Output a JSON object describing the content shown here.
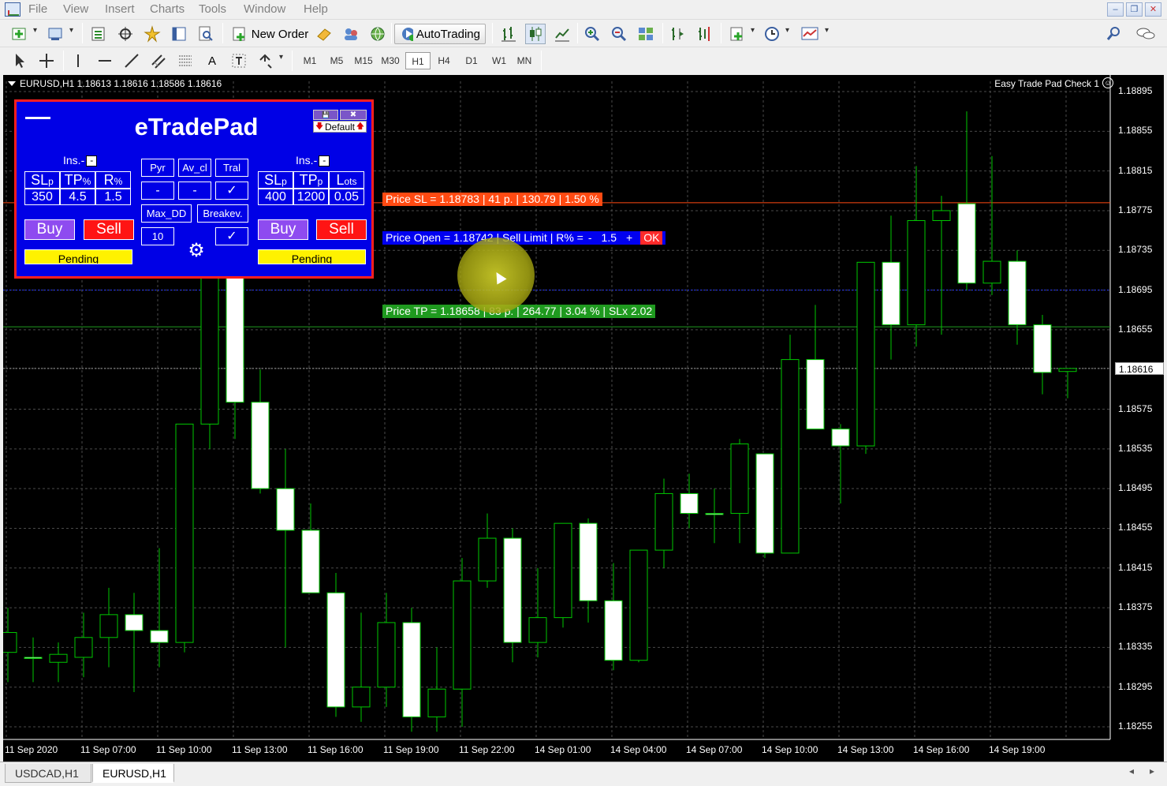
{
  "menu": [
    "File",
    "View",
    "Insert",
    "Charts",
    "Tools",
    "Window",
    "Help"
  ],
  "window_controls": [
    "minimize",
    "restore",
    "close"
  ],
  "toolbar": {
    "new_order_label": "New Order",
    "autotrading_label": "AutoTrading",
    "timeframes": [
      "M1",
      "M5",
      "M15",
      "M30",
      "H1",
      "H4",
      "D1",
      "W1",
      "MN"
    ],
    "active_timeframe": "H1",
    "text_tool_label": "A"
  },
  "chart": {
    "header": "EURUSD,H1  1.18613 1.18616 1.18586 1.18616",
    "ea_name": "Easy Trade Pad Check 1",
    "price_axis": [
      "1.18895",
      "1.18855",
      "1.18815",
      "1.18775",
      "1.18735",
      "1.18695",
      "1.18655",
      "1.18616",
      "1.18575",
      "1.18535",
      "1.18495",
      "1.18455",
      "1.18415",
      "1.18375",
      "1.18335",
      "1.18295",
      "1.18255"
    ],
    "current_price": "1.18616",
    "time_axis": [
      "11 Sep 2020",
      "11 Sep 07:00",
      "11 Sep 10:00",
      "11 Sep 13:00",
      "11 Sep 16:00",
      "11 Sep 19:00",
      "11 Sep 22:00",
      "14 Sep 01:00",
      "14 Sep 04:00",
      "14 Sep 07:00",
      "14 Sep 10:00",
      "14 Sep 13:00",
      "14 Sep 16:00",
      "14 Sep 19:00"
    ],
    "sl_label": "Price SL = 1.18783 | 41 p. | 130.79  | 1.50 %",
    "open_label": {
      "text": "Price Open = 1.18742 | Sell Limit | R% = ",
      "minus": "-",
      "value": "1.5",
      "plus": "+",
      "ok": "OK"
    },
    "tp_label": "Price TP = 1.18658 | 83 p. | 264.77  | 3.04 % | SLx 2.02",
    "colors": {
      "background": "#000000",
      "bull_candle": "#000000",
      "bear_candle": "#ffffff",
      "candle_outline": "#00c800",
      "sl_line": "#ff4a12",
      "open_line": "#2030ff",
      "tp_line": "#1f9a1f"
    },
    "candles": [
      {
        "o": 1.1833,
        "h": 1.18375,
        "l": 1.183,
        "c": 1.1835
      },
      {
        "o": 1.18325,
        "h": 1.18345,
        "l": 1.183,
        "c": 1.18325
      },
      {
        "o": 1.1832,
        "h": 1.1834,
        "l": 1.183,
        "c": 1.18328
      },
      {
        "o": 1.18325,
        "h": 1.1837,
        "l": 1.18305,
        "c": 1.18345
      },
      {
        "o": 1.18345,
        "h": 1.18395,
        "l": 1.18315,
        "c": 1.18368
      },
      {
        "o": 1.18368,
        "h": 1.1839,
        "l": 1.1829,
        "c": 1.18352
      },
      {
        "o": 1.18352,
        "h": 1.18435,
        "l": 1.18315,
        "c": 1.1834
      },
      {
        "o": 1.1834,
        "h": 1.18505,
        "l": 1.1833,
        "c": 1.1856
      },
      {
        "o": 1.1856,
        "h": 1.1874,
        "l": 1.18535,
        "c": 1.1873
      },
      {
        "o": 1.1873,
        "h": 1.188,
        "l": 1.18545,
        "c": 1.18582
      },
      {
        "o": 1.18582,
        "h": 1.18615,
        "l": 1.1849,
        "c": 1.18495
      },
      {
        "o": 1.18495,
        "h": 1.18535,
        "l": 1.18335,
        "c": 1.18453
      },
      {
        "o": 1.18453,
        "h": 1.1848,
        "l": 1.1839,
        "c": 1.1839
      },
      {
        "o": 1.1839,
        "h": 1.1841,
        "l": 1.18265,
        "c": 1.18275
      },
      {
        "o": 1.18275,
        "h": 1.1837,
        "l": 1.1826,
        "c": 1.18295
      },
      {
        "o": 1.18295,
        "h": 1.1839,
        "l": 1.18275,
        "c": 1.1836
      },
      {
        "o": 1.1836,
        "h": 1.18375,
        "l": 1.1825,
        "c": 1.18265
      },
      {
        "o": 1.18265,
        "h": 1.18335,
        "l": 1.1825,
        "c": 1.18293
      },
      {
        "o": 1.18293,
        "h": 1.18425,
        "l": 1.18255,
        "c": 1.18402
      },
      {
        "o": 1.18402,
        "h": 1.1847,
        "l": 1.18395,
        "c": 1.18445
      },
      {
        "o": 1.18445,
        "h": 1.18455,
        "l": 1.1832,
        "c": 1.1834
      },
      {
        "o": 1.1834,
        "h": 1.18415,
        "l": 1.18325,
        "c": 1.18365
      },
      {
        "o": 1.18365,
        "h": 1.1846,
        "l": 1.18355,
        "c": 1.1846
      },
      {
        "o": 1.1846,
        "h": 1.18465,
        "l": 1.1836,
        "c": 1.18382
      },
      {
        "o": 1.18382,
        "h": 1.1842,
        "l": 1.18312,
        "c": 1.18322
      },
      {
        "o": 1.18322,
        "h": 1.18425,
        "l": 1.1832,
        "c": 1.18433
      },
      {
        "o": 1.18433,
        "h": 1.18505,
        "l": 1.18415,
        "c": 1.1849
      },
      {
        "o": 1.1849,
        "h": 1.1851,
        "l": 1.18455,
        "c": 1.1847
      },
      {
        "o": 1.1847,
        "h": 1.18495,
        "l": 1.1844,
        "c": 1.1847
      },
      {
        "o": 1.1847,
        "h": 1.18545,
        "l": 1.1844,
        "c": 1.1854
      },
      {
        "o": 1.1853,
        "h": 1.1853,
        "l": 1.18425,
        "c": 1.1843
      },
      {
        "o": 1.1843,
        "h": 1.1865,
        "l": 1.1843,
        "c": 1.18625
      },
      {
        "o": 1.18625,
        "h": 1.1868,
        "l": 1.18555,
        "c": 1.18555
      },
      {
        "o": 1.18555,
        "h": 1.1856,
        "l": 1.1848,
        "c": 1.18538
      },
      {
        "o": 1.18538,
        "h": 1.1871,
        "l": 1.1853,
        "c": 1.18723
      },
      {
        "o": 1.18723,
        "h": 1.1877,
        "l": 1.18625,
        "c": 1.1866
      },
      {
        "o": 1.1866,
        "h": 1.1882,
        "l": 1.18638,
        "c": 1.18765
      },
      {
        "o": 1.18765,
        "h": 1.1879,
        "l": 1.1865,
        "c": 1.18775
      },
      {
        "o": 1.18782,
        "h": 1.18875,
        "l": 1.18695,
        "c": 1.18702
      },
      {
        "o": 1.18702,
        "h": 1.1883,
        "l": 1.1869,
        "c": 1.18724
      },
      {
        "o": 1.18724,
        "h": 1.18735,
        "l": 1.1864,
        "c": 1.1866
      },
      {
        "o": 1.1866,
        "h": 1.1867,
        "l": 1.1859,
        "c": 1.18612
      },
      {
        "o": 1.18613,
        "h": 1.18616,
        "l": 1.18586,
        "c": 1.18616
      }
    ]
  },
  "tradepad": {
    "title": "eTradePad",
    "default_label": "Default",
    "left": {
      "ins_label": "Ins.-",
      "headers": [
        {
          "big": "SL",
          "small": "p"
        },
        {
          "big": "TP",
          "small": "%"
        },
        {
          "big": "R",
          "small": "%"
        }
      ],
      "values": [
        "350",
        "4.5",
        "1.5"
      ],
      "buy": "Buy",
      "sell": "Sell",
      "pending": "Pending"
    },
    "middle": {
      "row1": [
        "Pyr",
        "Av_cl",
        "Tral"
      ],
      "row2": [
        "-",
        "-",
        "✓"
      ],
      "maxdd_label": "Max_DD",
      "breakeven_label": "Breakev.",
      "maxdd_value": "10",
      "breakeven_check": "✓"
    },
    "right": {
      "ins_label": "Ins.-",
      "headers": [
        {
          "big": "SL",
          "small": "p"
        },
        {
          "big": "TP",
          "small": "p"
        },
        {
          "big": "L",
          "small": "ots"
        }
      ],
      "values": [
        "400",
        "1200",
        "0.05"
      ],
      "buy": "Buy",
      "sell": "Sell",
      "pending": "Pending"
    }
  },
  "tabs": [
    "USDCAD,H1",
    "EURUSD,H1"
  ],
  "active_tab": "EURUSD,H1"
}
